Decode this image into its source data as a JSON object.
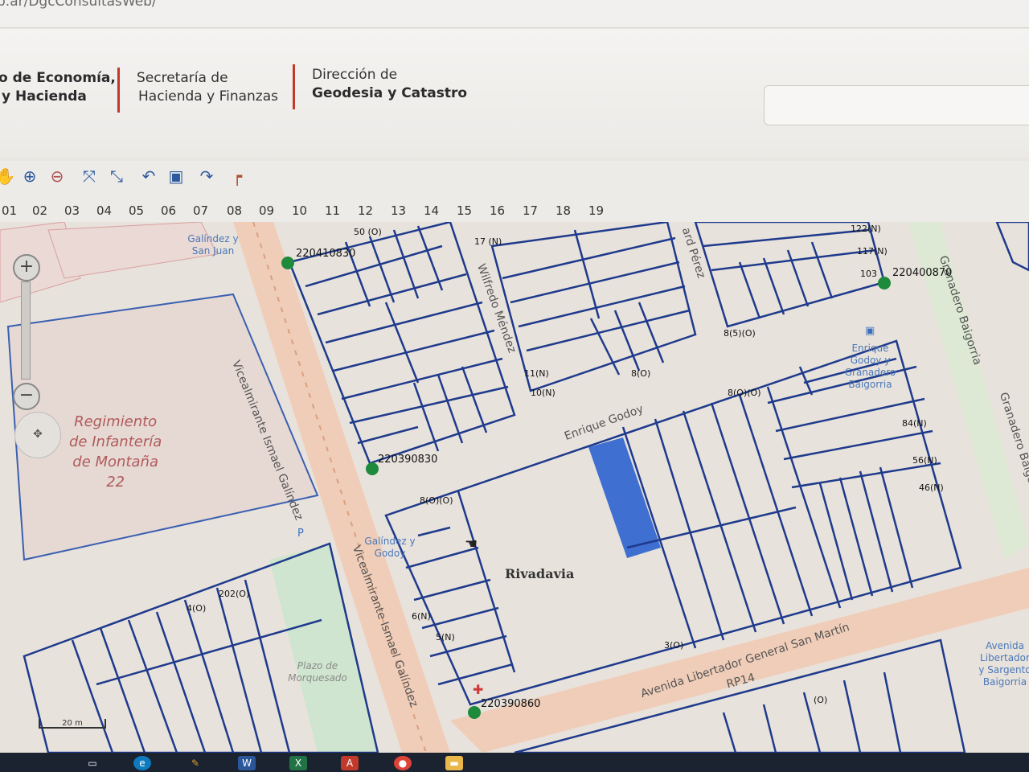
{
  "browser": {
    "url": "b.ar/DgcConsultasWeb/"
  },
  "header": {
    "org1_line1": "o de Economía,",
    "org1_line2": "y Hacienda",
    "org2_line1": "Secretaría de",
    "org2_line2": "Hacienda y Finanzas",
    "org3_line1": "Dirección de",
    "org3_line2": "Geodesia y Catastro",
    "accent_color": "#c0392b"
  },
  "toolbar": {
    "tools": [
      "pan-icon",
      "zoom-in-icon",
      "zoom-out-icon",
      "full-extent-icon",
      "zoom-extent-icon",
      "undo-icon",
      "select-icon",
      "redo-icon",
      "measure-icon"
    ]
  },
  "layers": [
    "01",
    "02",
    "03",
    "04",
    "05",
    "06",
    "07",
    "08",
    "09",
    "10",
    "11",
    "12",
    "13",
    "14",
    "15",
    "16",
    "17",
    "18",
    "19"
  ],
  "map": {
    "area_label": [
      "Regimiento",
      "de Infantería",
      "de Montaña",
      "22"
    ],
    "locality": "Rivadavia",
    "streets": {
      "vicealmirante_1": "Vicealmirante Ismael Galíndez",
      "vicealmirante_2": "Vicealmirante Ismael Galíndez",
      "wilfredo": "Wilfredo Méndez",
      "enrique": "Enrique Godoy",
      "avenida": "Avenida Libertador General San Martín",
      "granadero_1": "Granadero Baigorria",
      "granadero_2": "Granadero Baigorria",
      "bard": "ard Pérez",
      "rp14": "RP14"
    },
    "pois": {
      "galindez_sanjuan": "Galíndez y San Juan",
      "galindez_godoy": "Galíndez y Godoy",
      "godoy_granadero": "Enrique Godoy y Granadero Baigorria",
      "plazo": "Plazo de Morquesado",
      "avenida_poi": "Avenida Libertador y Sargento Baigorria"
    },
    "parcel_codes": {
      "c1": "220410830",
      "c2": "220400870",
      "c3": "220390830",
      "c4": "220390860"
    },
    "small_labels": {
      "s1": "50 (O)",
      "s2": "17 (N)",
      "s3": "122(N)",
      "s4": "117(N)",
      "s5": "103",
      "s6": "8(5)(O)",
      "s7": "11(N)",
      "s8": "10(N)",
      "s9": "8(O)",
      "s10": "8(O)(O)",
      "s11": "84(N)",
      "s12": "56(N)",
      "s13": "46(N)",
      "s14": "8(O)(O)",
      "s15": "6(N)",
      "s16": "5(N)",
      "s17": "202(O)",
      "s18": "4(O)",
      "s19": "(O)",
      "s20": "3(O)"
    },
    "scale": "20 m",
    "highlight_color": "#3f6fd0"
  },
  "taskbar": {
    "icons": [
      "task-view-icon",
      "edge-icon",
      "pen-icon",
      "word-icon",
      "excel-icon",
      "acrobat-icon",
      "chrome-icon",
      "folder-icon"
    ]
  }
}
